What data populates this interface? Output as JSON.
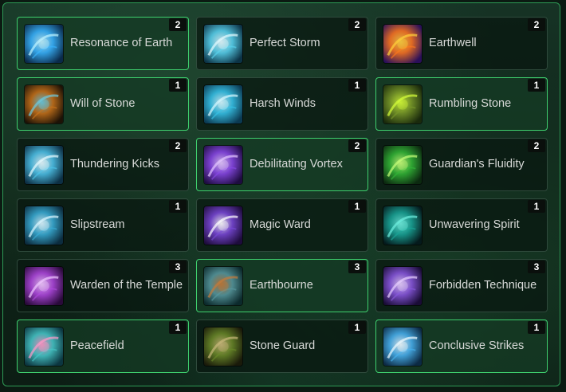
{
  "cards": [
    {
      "label": "Resonance of Earth",
      "count": "2",
      "icon": "resonance-of-earth-icon",
      "colors": [
        "#0a2a4a",
        "#3ab6ff",
        "#bff3ff"
      ],
      "active": true
    },
    {
      "label": "Perfect Storm",
      "count": "2",
      "icon": "perfect-storm-icon",
      "colors": [
        "#0c3346",
        "#5bd5f0",
        "#e6fbff"
      ],
      "active": false
    },
    {
      "label": "Earthwell",
      "count": "2",
      "icon": "earthwell-icon",
      "colors": [
        "#2a0f5a",
        "#ff7a1a",
        "#ffd23a"
      ],
      "active": false
    },
    {
      "label": "Will of Stone",
      "count": "1",
      "icon": "will-of-stone-icon",
      "colors": [
        "#1d1206",
        "#c9741c",
        "#6ecbe0"
      ],
      "active": true
    },
    {
      "label": "Harsh Winds",
      "count": "1",
      "icon": "harsh-winds-icon",
      "colors": [
        "#0b3a52",
        "#38c4e8",
        "#d8f8ff"
      ],
      "active": false
    },
    {
      "label": "Rumbling Stone",
      "count": "1",
      "icon": "rumbling-stone-icon",
      "colors": [
        "#1a2a0c",
        "#7a9a2a",
        "#d6ff3a"
      ],
      "active": true
    },
    {
      "label": "Thundering Kicks",
      "count": "2",
      "icon": "thundering-kicks-icon",
      "colors": [
        "#0d2f44",
        "#4fc4ea",
        "#e8fbff"
      ],
      "active": false
    },
    {
      "label": "Debilitating Vortex",
      "count": "2",
      "icon": "debilitating-vortex-icon",
      "colors": [
        "#1e0c40",
        "#8a4ae8",
        "#e4c8ff"
      ],
      "active": true
    },
    {
      "label": "Guardian's Fluidity",
      "count": "2",
      "icon": "guardians-fluidity-icon",
      "colors": [
        "#0c2a10",
        "#34b838",
        "#c8ff7a"
      ],
      "active": false
    },
    {
      "label": "Slipstream",
      "count": "1",
      "icon": "slipstream-icon",
      "colors": [
        "#0c2c3e",
        "#3aaed6",
        "#dcf6ff"
      ],
      "active": false
    },
    {
      "label": "Magic Ward",
      "count": "1",
      "icon": "magic-ward-icon",
      "colors": [
        "#1e0c3c",
        "#7a4ad8",
        "#ffffff"
      ],
      "active": false
    },
    {
      "label": "Unwavering Spirit",
      "count": "1",
      "icon": "unwavering-spirit-icon",
      "colors": [
        "#051a1c",
        "#1aa89a",
        "#6ff0e0"
      ],
      "active": false
    },
    {
      "label": "Warden of the Temple",
      "count": "3",
      "icon": "warden-of-the-temple-icon",
      "colors": [
        "#2a0a3a",
        "#b04ae0",
        "#f0c8ff"
      ],
      "active": false
    },
    {
      "label": "Earthbourne",
      "count": "3",
      "icon": "earthbourne-icon",
      "colors": [
        "#0c2a2c",
        "#5a9aa0",
        "#c47a3a"
      ],
      "active": true
    },
    {
      "label": "Forbidden Technique",
      "count": "3",
      "icon": "forbidden-technique-icon",
      "colors": [
        "#1a0c36",
        "#8a5ae0",
        "#e8d0ff"
      ],
      "active": false
    },
    {
      "label": "Peacefield",
      "count": "1",
      "icon": "peacefield-icon",
      "colors": [
        "#0c3640",
        "#48c8c8",
        "#ff9ac8"
      ],
      "active": true
    },
    {
      "label": "Stone Guard",
      "count": "1",
      "icon": "stone-guard-icon",
      "colors": [
        "#1a1a0a",
        "#6a8a2a",
        "#c8b87a"
      ],
      "active": false
    },
    {
      "label": "Conclusive Strikes",
      "count": "1",
      "icon": "conclusive-strikes-icon",
      "colors": [
        "#0c2a44",
        "#4ab4f0",
        "#f0fbff"
      ],
      "active": true
    }
  ]
}
